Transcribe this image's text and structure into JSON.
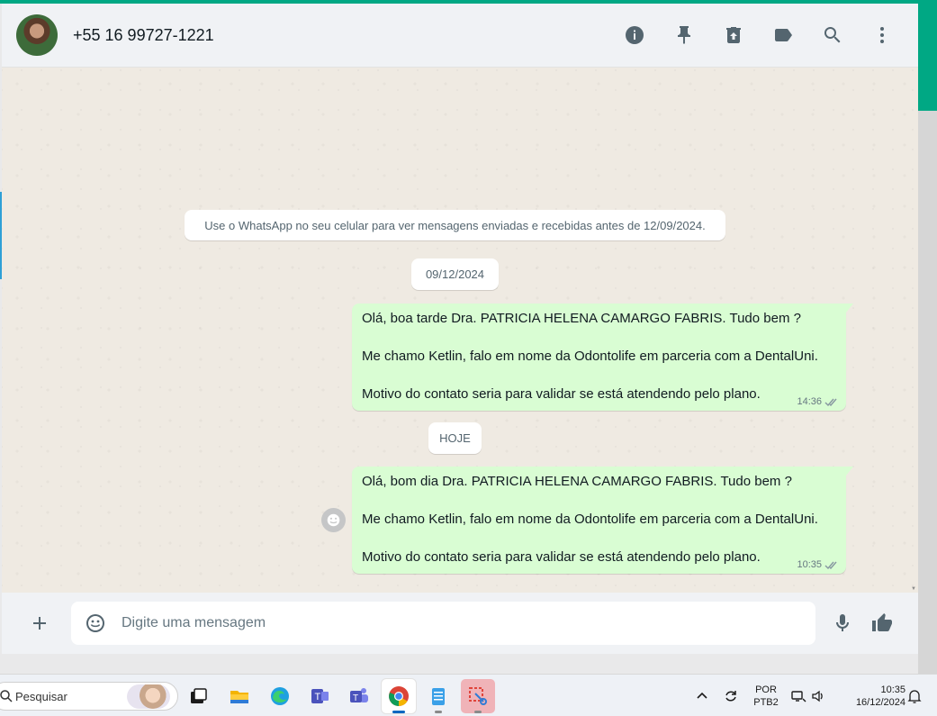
{
  "header": {
    "contact_name": "+55 16 99727-1221",
    "icons": [
      "info-icon",
      "pin-icon",
      "delete-icon",
      "label-icon",
      "search-icon",
      "menu-icon"
    ]
  },
  "chat": {
    "system_notice": "Use o WhatsApp no seu celular para ver mensagens enviadas e recebidas antes de 12/09/2024.",
    "date_1": "09/12/2024",
    "date_2": "HOJE",
    "messages": [
      {
        "lines": [
          "Olá, boa tarde Dra. PATRICIA HELENA CAMARGO FABRIS. Tudo bem ?",
          "Me chamo Ketlin, falo em nome da Odontolife em parceria com a DentalUni.",
          "Motivo do contato seria para validar se está atendendo pelo plano."
        ],
        "time": "14:36",
        "status": "read"
      },
      {
        "lines": [
          "Olá, bom dia Dra. PATRICIA HELENA CAMARGO FABRIS. Tudo bem ?",
          "Me chamo Ketlin, falo em nome da Odontolife em parceria com a DentalUni.",
          "Motivo do contato seria para validar se está atendendo pelo plano."
        ],
        "time": "10:35",
        "status": "read"
      }
    ]
  },
  "composer": {
    "placeholder": "Digite uma mensagem",
    "value": ""
  },
  "taskbar": {
    "search_label": "Pesquisar",
    "language": "POR",
    "keyboard": "PTB2",
    "time": "10:35",
    "date": "16/12/2024"
  },
  "colors": {
    "accent": "#00a884",
    "outgoing_bubble": "#d9fdd3",
    "chat_bg": "#efeae2",
    "header_bg": "#f0f2f5",
    "read_ticks": "#8696a0"
  }
}
